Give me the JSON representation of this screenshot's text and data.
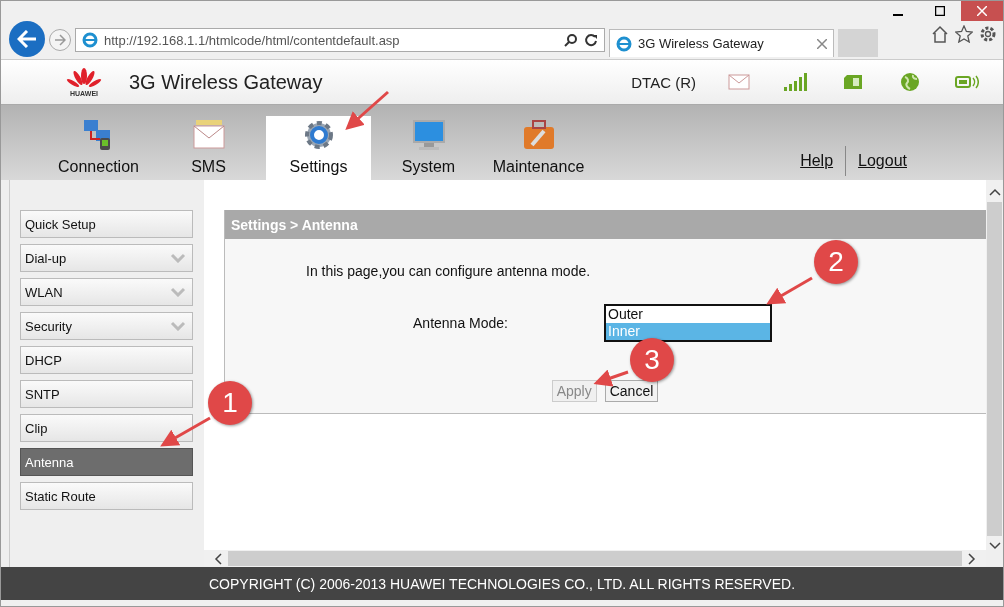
{
  "browser": {
    "address": "http://192.168.1.1/htmlcode/html/contentdefault.asp",
    "tab": {
      "title": "3G Wireless Gateway"
    }
  },
  "header": {
    "logo_text": "HUAWEI",
    "title": "3G Wireless Gateway",
    "operator": "DTAC (R)"
  },
  "nav": {
    "tabs": [
      {
        "label": "Connection",
        "selected": false
      },
      {
        "label": "SMS",
        "selected": false
      },
      {
        "label": "Settings",
        "selected": true
      },
      {
        "label": "System",
        "selected": false
      },
      {
        "label": "Maintenance",
        "selected": false
      }
    ],
    "links": [
      "Help",
      "Logout"
    ]
  },
  "sidebar": {
    "items": [
      {
        "label": "Quick Setup",
        "kind": "page",
        "selected": false
      },
      {
        "label": "Dial-up",
        "kind": "group",
        "selected": false
      },
      {
        "label": "WLAN",
        "kind": "group",
        "selected": false
      },
      {
        "label": "Security",
        "kind": "group",
        "selected": false
      },
      {
        "label": "DHCP",
        "kind": "page",
        "selected": false
      },
      {
        "label": "SNTP",
        "kind": "page",
        "selected": false
      },
      {
        "label": "Clip",
        "kind": "page",
        "selected": false
      },
      {
        "label": "Antenna",
        "kind": "page",
        "selected": true
      },
      {
        "label": "Static Route",
        "kind": "page",
        "selected": false
      }
    ]
  },
  "panel": {
    "breadcrumb": "Settings > Antenna",
    "intro": "In this page,you can configure antenna mode.",
    "field_label": "Antenna Mode:",
    "options": [
      {
        "label": "Outer",
        "selected": false
      },
      {
        "label": "Inner",
        "selected": true
      }
    ],
    "buttons": [
      {
        "label": "Apply",
        "disabled": true
      },
      {
        "label": "Cancel",
        "disabled": false
      }
    ]
  },
  "callouts": [
    {
      "number": "1"
    },
    {
      "number": "2"
    },
    {
      "number": "3"
    }
  ],
  "footer": "COPYRIGHT (C) 2006-2013 HUAWEI TECHNOLOGIES CO., LTD. ALL RIGHTS RESERVED."
}
